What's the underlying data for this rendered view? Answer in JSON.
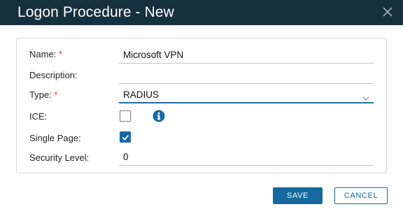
{
  "dialog": {
    "title": "Logon Procedure - New",
    "close_icon": "close-icon"
  },
  "form": {
    "name": {
      "label": "Name:",
      "required_mark": "*",
      "value": "Microsoft VPN"
    },
    "description": {
      "label": "Description:",
      "value": ""
    },
    "type": {
      "label": "Type:",
      "required_mark": "*",
      "value": "RADIUS",
      "icon": "chevron-down-icon"
    },
    "ice": {
      "label": "ICE:",
      "checked": false,
      "info_icon": "info-icon"
    },
    "single_page": {
      "label": "Single Page:",
      "checked": true
    },
    "security_level": {
      "label": "Security Level:",
      "value": "0"
    }
  },
  "buttons": {
    "save_label": "SAVE",
    "cancel_label": "CANCEL"
  },
  "colors": {
    "titlebar": "#17303d",
    "accent": "#1769a0",
    "required": "#e0302a"
  }
}
